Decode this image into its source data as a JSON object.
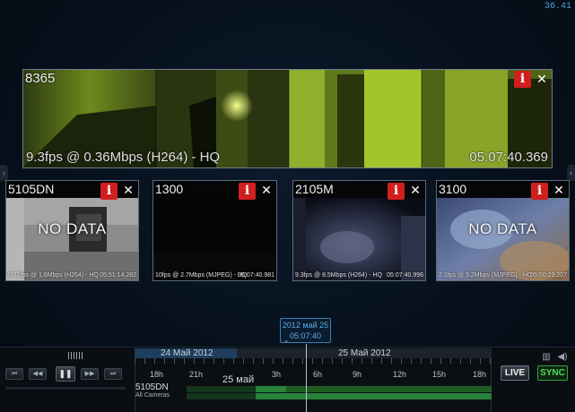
{
  "fps_counter": "36.41",
  "main_tile": {
    "name": "8365",
    "stats": "9.3fps @ 0.36Mbps (H264) - HQ",
    "time": "05:07:40.369"
  },
  "tiles": [
    {
      "name": "5105DN",
      "stats": "0.71fps @ 1.6Mbps (H264) - HQ",
      "time": "05:51:14.282",
      "overlay": "NO DATA"
    },
    {
      "name": "1300",
      "stats": "10fps @ 2.7Mbps (MJPEG) - HQ",
      "time": "05:07:40.981",
      "overlay": ""
    },
    {
      "name": "2105M",
      "stats": "9.3fps @ 8.5Mbps (H264) - HQ",
      "time": "05:07:40.996",
      "overlay": ""
    },
    {
      "name": "3100",
      "stats": "2.1fps @ 5.2Mbps (MJPEG) - HQ",
      "time": "05:50:29.207",
      "overlay": "NO DATA"
    }
  ],
  "buttons": {
    "info_glyph": "i",
    "close_glyph": "✕"
  },
  "cursor_tooltip": {
    "date": "2012 май 25",
    "time": "05:07:40"
  },
  "timeline": {
    "dates": [
      "24 Май 2012",
      "25 Май 2012"
    ],
    "hours": [
      "18h",
      "21h",
      "3h",
      "6h",
      "9h",
      "12h",
      "15h",
      "18h"
    ],
    "day_label": "25 май",
    "camera": "5105DN",
    "camera_group": "All Cameras"
  },
  "controls": {
    "live": "LIVE",
    "sync": "SYNC"
  },
  "colors": {
    "info_red": "#d11f1f",
    "sync_green": "#4fdd5a",
    "accent_blue": "#4aa3d8"
  }
}
